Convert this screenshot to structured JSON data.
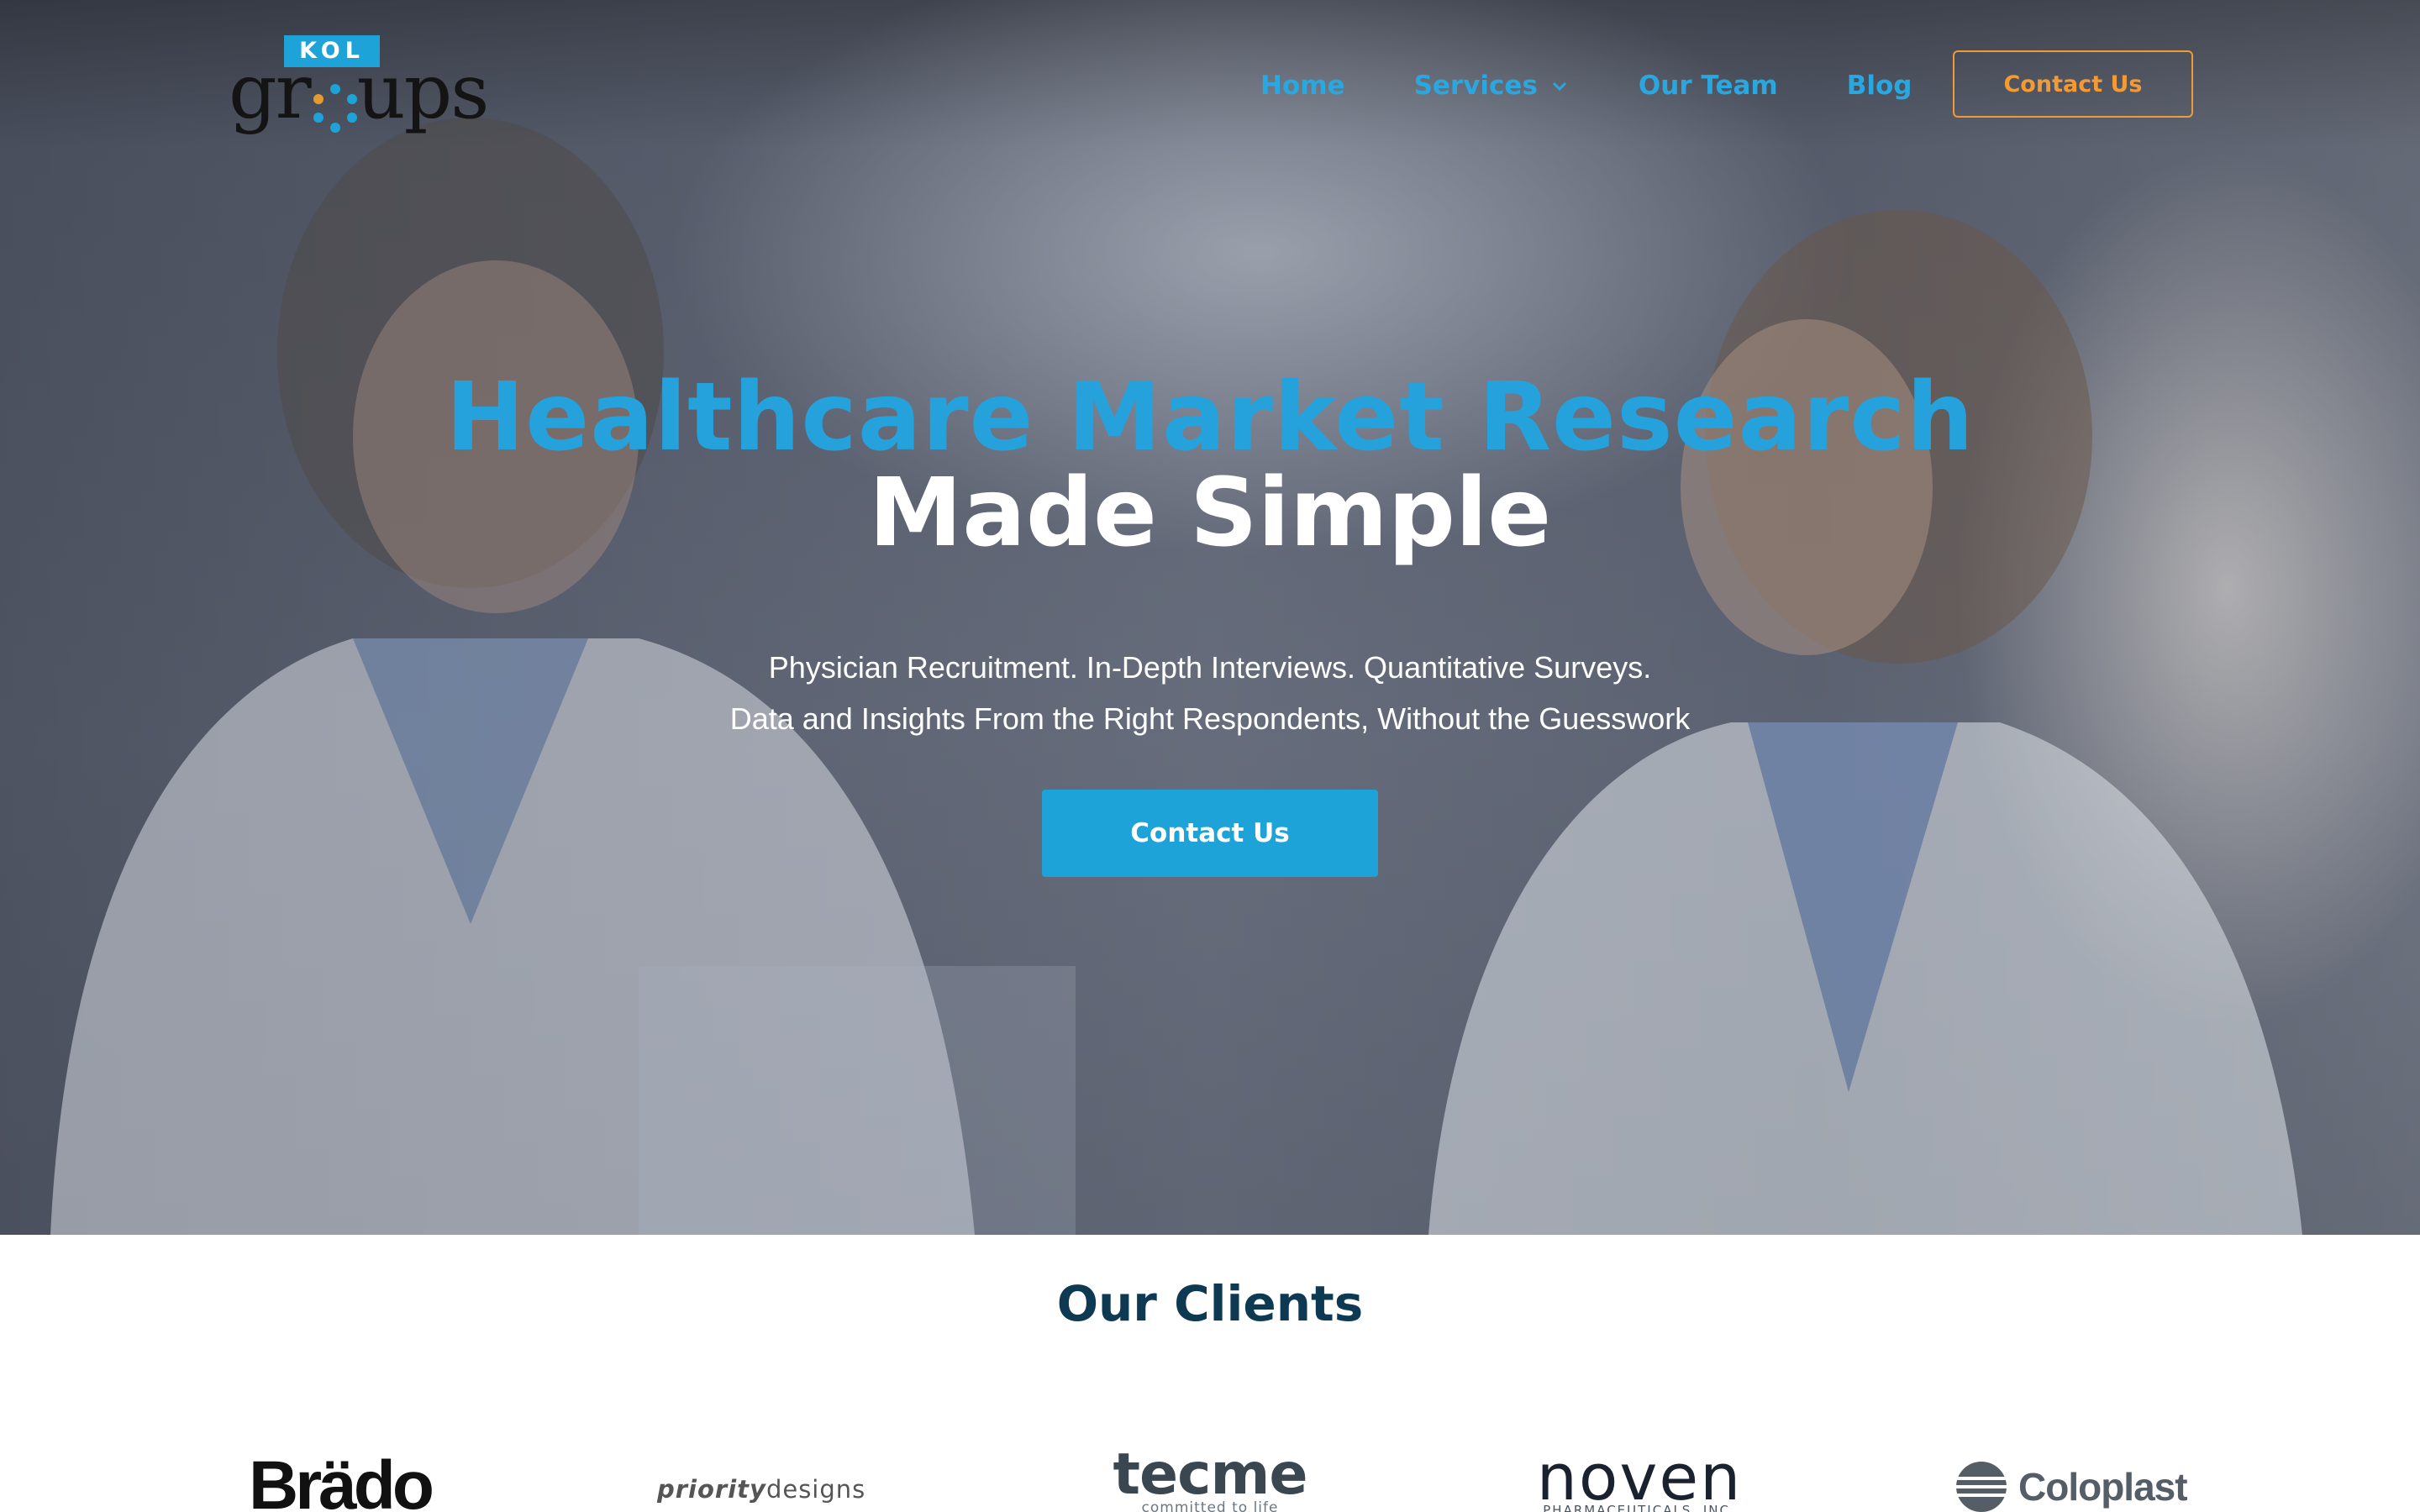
{
  "brand": {
    "badge": "KOL",
    "word_before": "gr",
    "word_after": "ups",
    "accent_color": "#1ea3d8"
  },
  "nav": {
    "items": [
      {
        "label": "Home"
      },
      {
        "label": "Services",
        "has_dropdown": true,
        "icon": "chevron-down-icon"
      },
      {
        "label": "Our Team"
      },
      {
        "label": "Blog"
      }
    ],
    "cta_label": "Contact Us",
    "cta_color": "#f29a35"
  },
  "hero": {
    "headline_line1": "Healthcare Market Research",
    "headline_line2": "Made Simple",
    "subline1": "Physician Recruitment. In-Depth Interviews. Quantitative Surveys.",
    "subline2": "Data and Insights From the Right Respondents, Without the Guesswork",
    "cta_label": "Contact Us",
    "headline_accent_color": "#25a2dc"
  },
  "clients": {
    "title": "Our Clients",
    "title_color": "#0d3a52",
    "logos": [
      {
        "name": "Brado",
        "text": "Brädo"
      },
      {
        "name": "Priority Designs",
        "text_a": "priority",
        "text_b": "designs"
      },
      {
        "name": "Tecme",
        "text": "tecme",
        "tagline": "committed to life"
      },
      {
        "name": "Noven",
        "text": "noven",
        "tagline": "PHARMACEUTICALS, INC."
      },
      {
        "name": "Coloplast",
        "text": "Coloplast",
        "icon": "coloplast-mark-icon"
      }
    ]
  }
}
